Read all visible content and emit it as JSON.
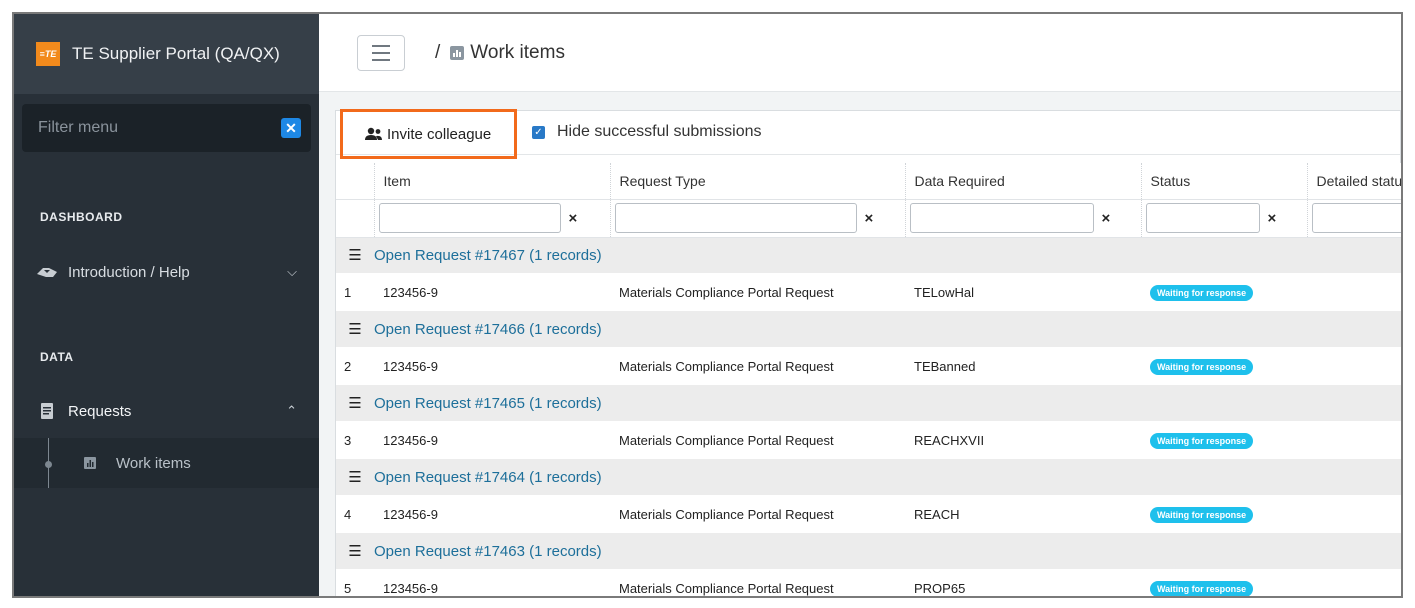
{
  "app": {
    "title": "TE Supplier Portal (QA/QX)",
    "logo_text": "≡TE",
    "accent": "#f26a1b"
  },
  "sidebar": {
    "filter_placeholder": "Filter menu",
    "sections": {
      "dashboard": "DASHBOARD",
      "data": "DATA"
    },
    "items": [
      {
        "label": "Introduction / Help",
        "icon": "handshake-icon"
      },
      {
        "label": "Requests",
        "icon": "document-icon"
      },
      {
        "label": "Work items",
        "icon": "chart-icon"
      }
    ]
  },
  "header": {
    "breadcrumb_sep": "/",
    "breadcrumb_label": "Work items"
  },
  "toolbar": {
    "invite_label": "Invite colleague",
    "hide_label": "Hide successful submissions"
  },
  "table": {
    "columns": [
      "Item",
      "Request Type",
      "Data Required",
      "Status",
      "Detailed status"
    ],
    "groups": [
      {
        "label": "Open Request #17467 (1 records)",
        "row": {
          "num": "1",
          "item": "123456-9",
          "type": "Materials Compliance Portal Request",
          "data": "TELowHal",
          "status": "Waiting for response"
        }
      },
      {
        "label": "Open Request #17466 (1 records)",
        "row": {
          "num": "2",
          "item": "123456-9",
          "type": "Materials Compliance Portal Request",
          "data": "TEBanned",
          "status": "Waiting for response"
        }
      },
      {
        "label": "Open Request #17465 (1 records)",
        "row": {
          "num": "3",
          "item": "123456-9",
          "type": "Materials Compliance Portal Request",
          "data": "REACHXVII",
          "status": "Waiting for response"
        }
      },
      {
        "label": "Open Request #17464 (1 records)",
        "row": {
          "num": "4",
          "item": "123456-9",
          "type": "Materials Compliance Portal Request",
          "data": "REACH",
          "status": "Waiting for response"
        }
      },
      {
        "label": "Open Request #17463 (1 records)",
        "row": {
          "num": "5",
          "item": "123456-9",
          "type": "Materials Compliance Portal Request",
          "data": "PROP65",
          "status": "Waiting for response"
        }
      }
    ]
  }
}
